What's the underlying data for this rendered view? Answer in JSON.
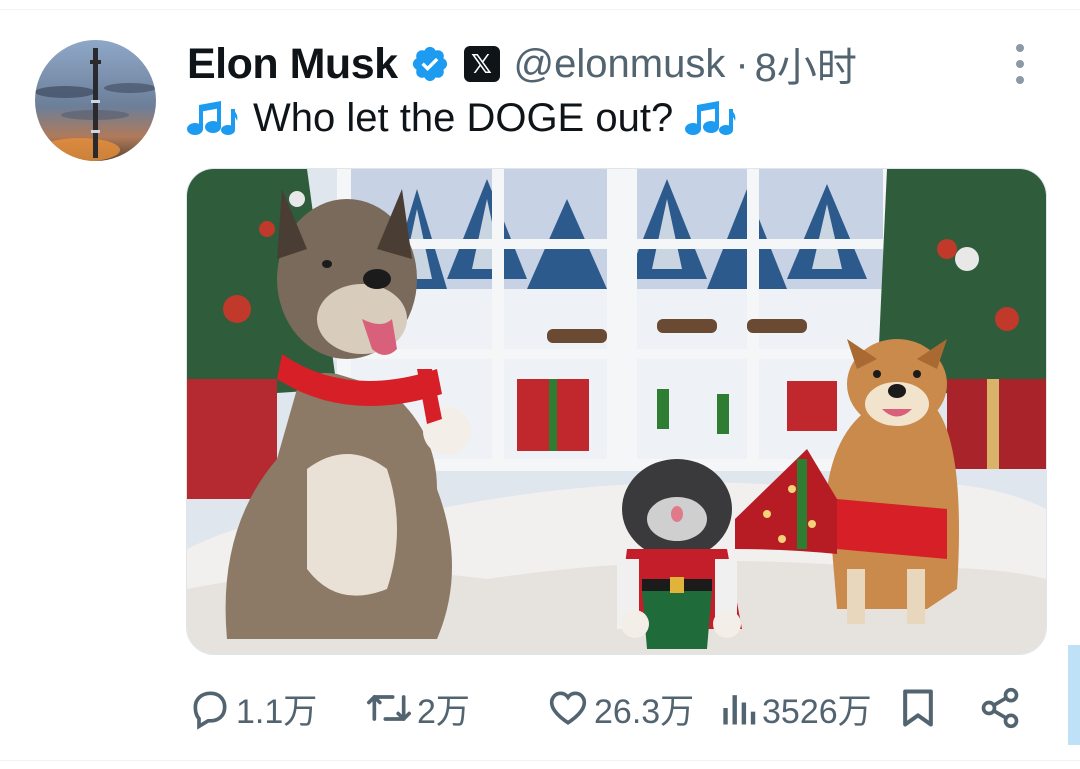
{
  "tweet": {
    "author_name": "Elon Musk",
    "verified": true,
    "affiliate_badge_icon": "x-logo",
    "handle": "@elonmusk",
    "separator": "·",
    "time_ago": "8小时",
    "text": "Who let the DOGE out?",
    "text_decoration_icon": "musical-notes",
    "media": {
      "type": "photo",
      "description_icon": "dogs-christmas-photo"
    }
  },
  "actions": {
    "reply_count": "1.1万",
    "retweet_count": "2万",
    "like_count": "26.3万",
    "view_count": "3526万"
  },
  "colors": {
    "text_primary": "#0f1419",
    "text_secondary": "#536471",
    "verified_blue": "#1d9bf0",
    "divider": "#eff3f4"
  }
}
